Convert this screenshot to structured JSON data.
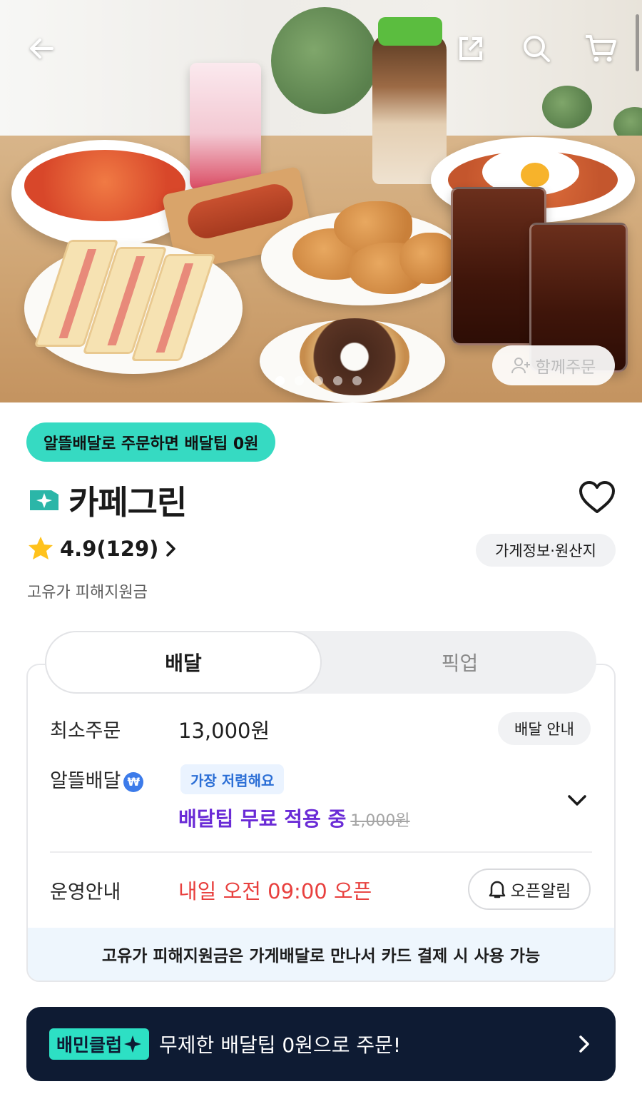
{
  "hero": {
    "together_order_label": "함께주문",
    "carousel_dots": 5,
    "active_dot": 0
  },
  "promo_badge": "알뜰배달로 주문하면 배달팁 0원",
  "store": {
    "name": "카페그린",
    "rating": "4.9(129)",
    "info_chip": "가게정보·원산지",
    "sub_note": "고유가 피해지원금"
  },
  "tabs": {
    "delivery": "배달",
    "pickup": "픽업"
  },
  "order": {
    "min_order_label": "최소주문",
    "min_order_value": "13,000원",
    "delivery_guide": "배달 안내",
    "saving_delivery_label": "알뜰배달",
    "won_icon": "₩",
    "cheapest_chip": "가장 저렴해요",
    "free_tip_text": "배달팁 무료 적용 중",
    "original_tip": "1,000원",
    "operation_label": "운영안내",
    "open_time": "내일 오전 09:00 오픈",
    "open_alarm": "오픈알림",
    "notice": "고유가 피해지원금은 가게배달로 만나서 카드 결제 시 사용 가능"
  },
  "club_banner": {
    "tag": "배민클럽",
    "text": "무제한 배달팁 0원으로 주문!"
  },
  "colors": {
    "promo_bg": "#36dac2",
    "accent_purple": "#6a2bd6",
    "open_red": "#e8403e",
    "banner_bg": "#0e1b33",
    "club_mint": "#2de0c4"
  }
}
